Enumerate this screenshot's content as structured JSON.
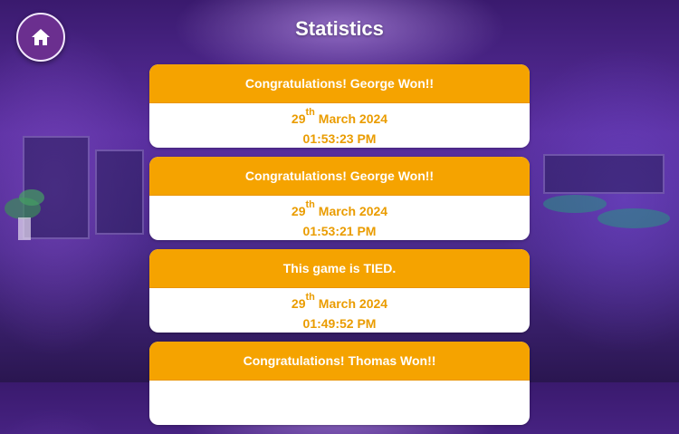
{
  "header": {
    "title": "Statistics",
    "home_icon": "home-icon"
  },
  "colors": {
    "card_header": "#f5a300",
    "card_text": "#ea9c00",
    "home_button": "#6b2f8f"
  },
  "games": [
    {
      "result": "Congratulations! George Won!!",
      "day": "29",
      "suffix": "th",
      "month_year": "March 2024",
      "time": "01:53:23 PM"
    },
    {
      "result": "Congratulations! George Won!!",
      "day": "29",
      "suffix": "th",
      "month_year": "March 2024",
      "time": "01:53:21 PM"
    },
    {
      "result": "This game is TIED.",
      "day": "29",
      "suffix": "th",
      "month_year": "March 2024",
      "time": "01:49:52 PM"
    },
    {
      "result": "Congratulations! Thomas Won!!",
      "day": "",
      "suffix": "",
      "month_year": "",
      "time": ""
    }
  ]
}
